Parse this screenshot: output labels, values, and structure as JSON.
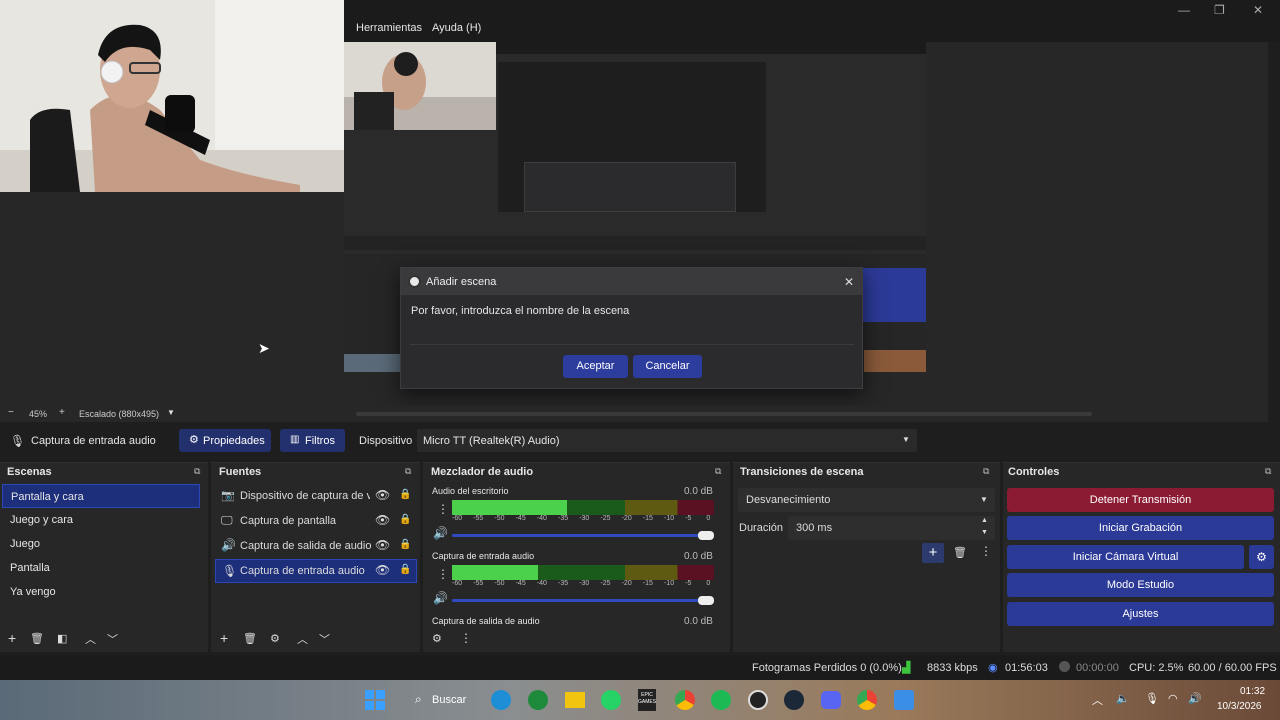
{
  "menu": {
    "items": [
      "Herramientas",
      "Ayuda (H)"
    ]
  },
  "window": {
    "minimize": "—",
    "maximize": "❐",
    "close": "✕"
  },
  "dialog": {
    "title": "Añadir escena",
    "prompt": "Por favor, introduzca el nombre de la escena",
    "input_value": "",
    "accept": "Aceptar",
    "cancel": "Cancelar",
    "close": "✕"
  },
  "zoom": {
    "minus": "−",
    "value": "45%",
    "plus": "+",
    "scale": "Escalado (880x495)"
  },
  "source_bar": {
    "source": "Captura de entrada audio",
    "properties": "Propiedades",
    "filters": "Filtros",
    "device_label": "Dispositivo",
    "device_value": "Micro TT (Realtek(R) Audio)"
  },
  "scenes": {
    "title": "Escenas",
    "items": [
      "Pantalla y cara",
      "Juego y cara",
      "Juego",
      "Pantalla",
      "Ya vengo"
    ],
    "selected": 0
  },
  "sources": {
    "title": "Fuentes",
    "items": [
      {
        "label": "Dispositivo de captura de vi",
        "icon": "camera-icon"
      },
      {
        "label": "Captura de pantalla",
        "icon": "monitor-icon"
      },
      {
        "label": "Captura de salida de audio",
        "icon": "speaker-icon"
      },
      {
        "label": "Captura de entrada audio",
        "icon": "microphone-icon"
      }
    ],
    "selected": 3
  },
  "mixer": {
    "title": "Mezclador de audio",
    "channels": [
      {
        "name": "Audio del escritorio",
        "db": "0.0 dB",
        "level": 0.44
      },
      {
        "name": "Captura de entrada audio",
        "db": "0.0 dB",
        "level": 0.33
      },
      {
        "name": "Captura de salida de audio",
        "db": "0.0 dB",
        "level": 0
      }
    ],
    "scale": [
      "-60",
      "-55",
      "-50",
      "-45",
      "-40",
      "-35",
      "-30",
      "-25",
      "-20",
      "-15",
      "-10",
      "-5",
      "0"
    ]
  },
  "transitions": {
    "title": "Transiciones de escena",
    "type": "Desvanecimiento",
    "duration_label": "Duración",
    "duration_value": "300 ms"
  },
  "controls": {
    "title": "Controles",
    "stop_stream": "Detener Transmisión",
    "start_recording": "Iniciar Grabación",
    "virtual_cam": "Iniciar Cámara Virtual",
    "studio_mode": "Modo Estudio",
    "settings": "Ajustes"
  },
  "status": {
    "dropped": "Fotogramas Perdidos 0 (0.0%)",
    "bitrate": "8833 kbps",
    "stream_time": "01:56:03",
    "rec_time": "00:00:00",
    "cpu": "CPU: 2.5%",
    "fps": "60.00 / 60.00 FPS"
  },
  "taskbar": {
    "search": "Buscar",
    "time": "01:32",
    "date": "10/3/2026",
    "epic": "EPIC GAMES"
  },
  "colors": {
    "accent": "#2c3d9d",
    "stop": "#8b1a33",
    "selected": "#1d2e7a"
  }
}
